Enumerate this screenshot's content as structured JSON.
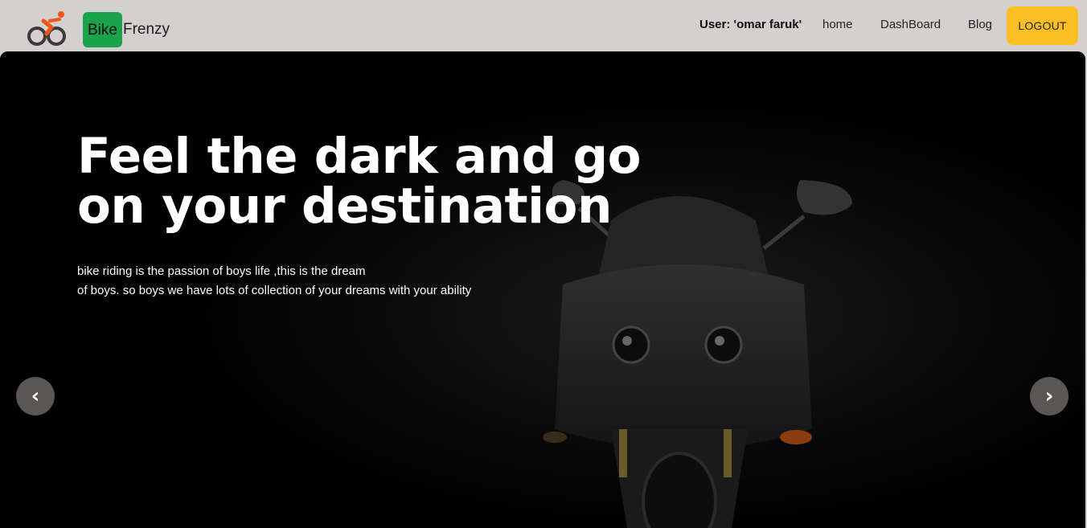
{
  "brand": {
    "badge": "Bike",
    "rest": "Frenzy",
    "logo_icon": "cyclist-icon",
    "badge_color": "#1aa34a"
  },
  "nav": {
    "user_label": "User: 'omar faruk'",
    "links": [
      "home",
      "DashBoard",
      "Blog"
    ],
    "logout": "LOGOUT",
    "logout_color": "#fbbf24",
    "background": "#d4d0cf"
  },
  "hero": {
    "title": "Feel the dark and go on your destination",
    "desc_line1": "bike riding is the passion of boys life ,this is the dream",
    "desc_line2": "of boys. so boys we have lots of collection of your dreams with your ability",
    "prev_icon": "‹",
    "next_icon": "›",
    "image": "black-motorcycle-front"
  }
}
